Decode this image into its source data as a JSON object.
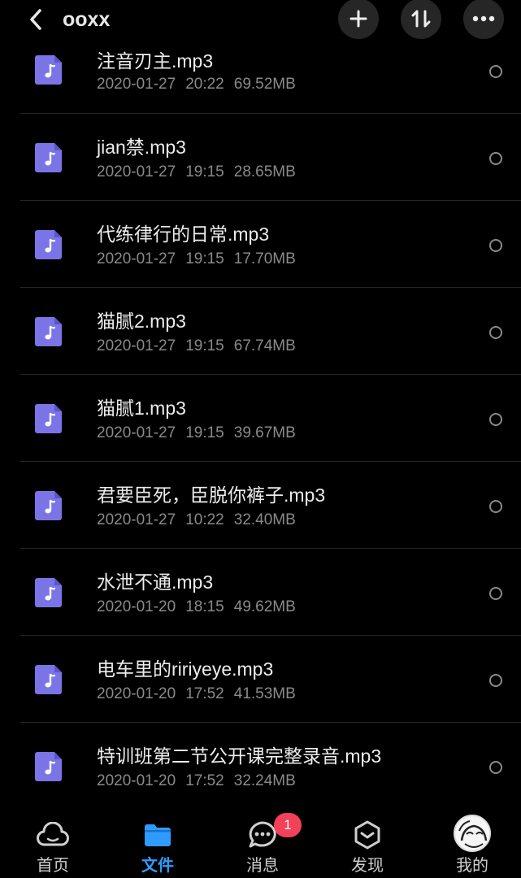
{
  "header": {
    "title": "ooxx"
  },
  "files": [
    {
      "name": "注音刃主.mp3",
      "date": "2020-01-27",
      "time": "20:22",
      "size": "69.52MB"
    },
    {
      "name": "jian禁.mp3",
      "date": "2020-01-27",
      "time": "19:15",
      "size": "28.65MB"
    },
    {
      "name": "代练律行的日常.mp3",
      "date": "2020-01-27",
      "time": "19:15",
      "size": "17.70MB"
    },
    {
      "name": "猫腻2.mp3",
      "date": "2020-01-27",
      "time": "19:15",
      "size": "67.74MB"
    },
    {
      "name": "猫腻1.mp3",
      "date": "2020-01-27",
      "time": "19:15",
      "size": "39.67MB"
    },
    {
      "name": "君要臣死，臣脱你裤子.mp3",
      "date": "2020-01-27",
      "time": "10:22",
      "size": "32.40MB"
    },
    {
      "name": "水泄不通.mp3",
      "date": "2020-01-20",
      "time": "18:15",
      "size": "49.62MB"
    },
    {
      "name": "电车里的ririyeye.mp3",
      "date": "2020-01-20",
      "time": "17:52",
      "size": "41.53MB"
    },
    {
      "name": "特训班第二节公开课完整录音.mp3",
      "date": "2020-01-20",
      "time": "17:52",
      "size": "32.24MB"
    }
  ],
  "nav": {
    "home": "首页",
    "files": "文件",
    "messages": "消息",
    "discover": "发现",
    "me": "我的",
    "messages_badge": "1"
  },
  "colors": {
    "accent": "#2f9bff",
    "file_icon": "#7b74e6",
    "badge": "#f24158",
    "background": "#000000"
  },
  "icons": {
    "back": "chevron-left-icon",
    "add": "plus-icon",
    "sort": "sort-arrows-icon",
    "more": "more-dots-icon",
    "file": "music-file-icon",
    "home": "cloud-icon",
    "files": "folder-icon",
    "messages": "chat-bubble-icon",
    "discover": "discover-hexagon-icon"
  }
}
